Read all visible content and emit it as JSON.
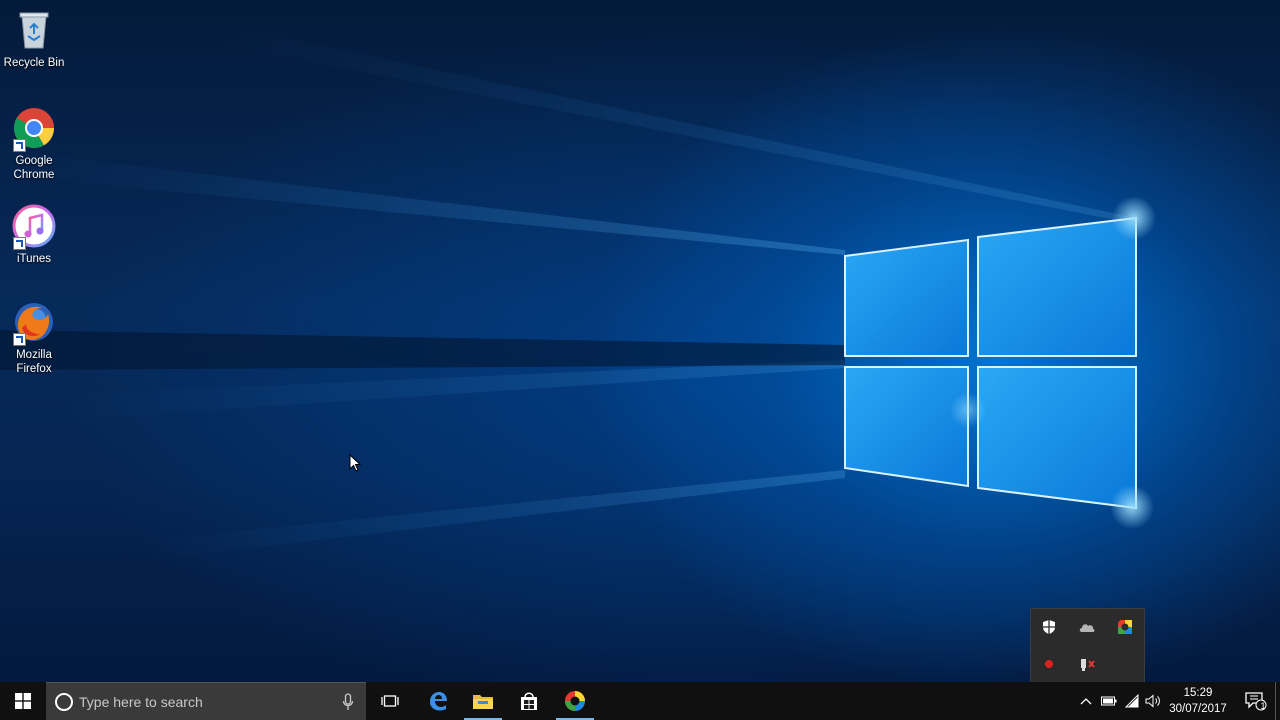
{
  "desktop": {
    "icons": [
      {
        "label": "Recycle Bin"
      },
      {
        "label": "Google Chrome"
      },
      {
        "label": "iTunes"
      },
      {
        "label": "Mozilla Firefox"
      }
    ]
  },
  "tray_overflow": {
    "icons": [
      "windows-defender-icon",
      "onedrive-icon",
      "app-color-icon",
      "record-icon",
      "usb-eject-icon"
    ]
  },
  "taskbar": {
    "search": {
      "placeholder": "Type here to search"
    },
    "pinned": [
      "task-view",
      "edge",
      "file-explorer",
      "store",
      "app"
    ],
    "clock": {
      "time": "15:29",
      "date": "30/07/2017"
    },
    "notifications": {
      "count": "1"
    }
  },
  "colors": {
    "taskbar": "#101010",
    "search_box": "#3a3a3a",
    "accent": "#76b9ed",
    "wallpaper_glow": "#0078d7"
  }
}
